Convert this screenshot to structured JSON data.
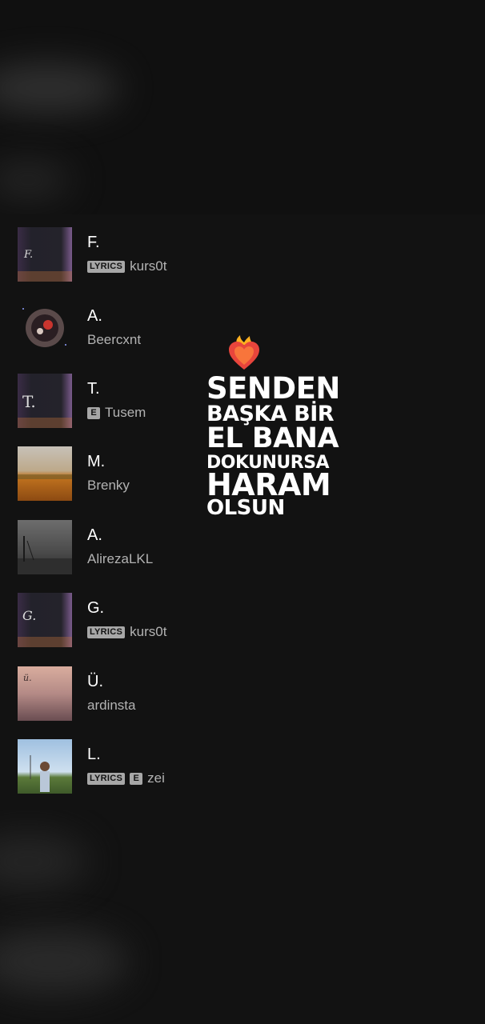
{
  "tracks": [
    {
      "title": "F.",
      "lyrics_badge": "LYRICS",
      "explicit_badge": "",
      "artist": "kurs0t",
      "cover": "dark-letter-f-cover"
    },
    {
      "title": "A.",
      "lyrics_badge": "",
      "explicit_badge": "",
      "artist": "Beercxnt",
      "cover": "space-sphere-cover"
    },
    {
      "title": "T.",
      "lyrics_badge": "",
      "explicit_badge": "E",
      "artist": "Tusem",
      "cover": "dark-letter-t-cover"
    },
    {
      "title": "M.",
      "lyrics_badge": "",
      "explicit_badge": "",
      "artist": "Brenky",
      "cover": "autumn-field-cover"
    },
    {
      "title": "A.",
      "lyrics_badge": "",
      "explicit_badge": "",
      "artist": "AlirezaLKL",
      "cover": "grey-road-cover"
    },
    {
      "title": "G.",
      "lyrics_badge": "LYRICS",
      "explicit_badge": "",
      "artist": "kurs0t",
      "cover": "dark-letter-g-cover"
    },
    {
      "title": "Ü.",
      "lyrics_badge": "",
      "explicit_badge": "",
      "artist": "ardinsta",
      "cover": "pink-sky-cover"
    },
    {
      "title": "L.",
      "lyrics_badge": "LYRICS",
      "explicit_badge": "E",
      "artist": "zei",
      "cover": "person-in-field-cover"
    }
  ],
  "overlay": {
    "icon": "burning-heart-icon",
    "lines": [
      "SENDEN",
      "BAŞKA BİR",
      "EL BANA",
      "DOKUNURSA",
      "HARAM",
      "OLSUN"
    ]
  },
  "colors": {
    "background": "#121212",
    "title": "#ffffff",
    "artist": "#b3b3b3",
    "badge": "#a7a7a7"
  }
}
